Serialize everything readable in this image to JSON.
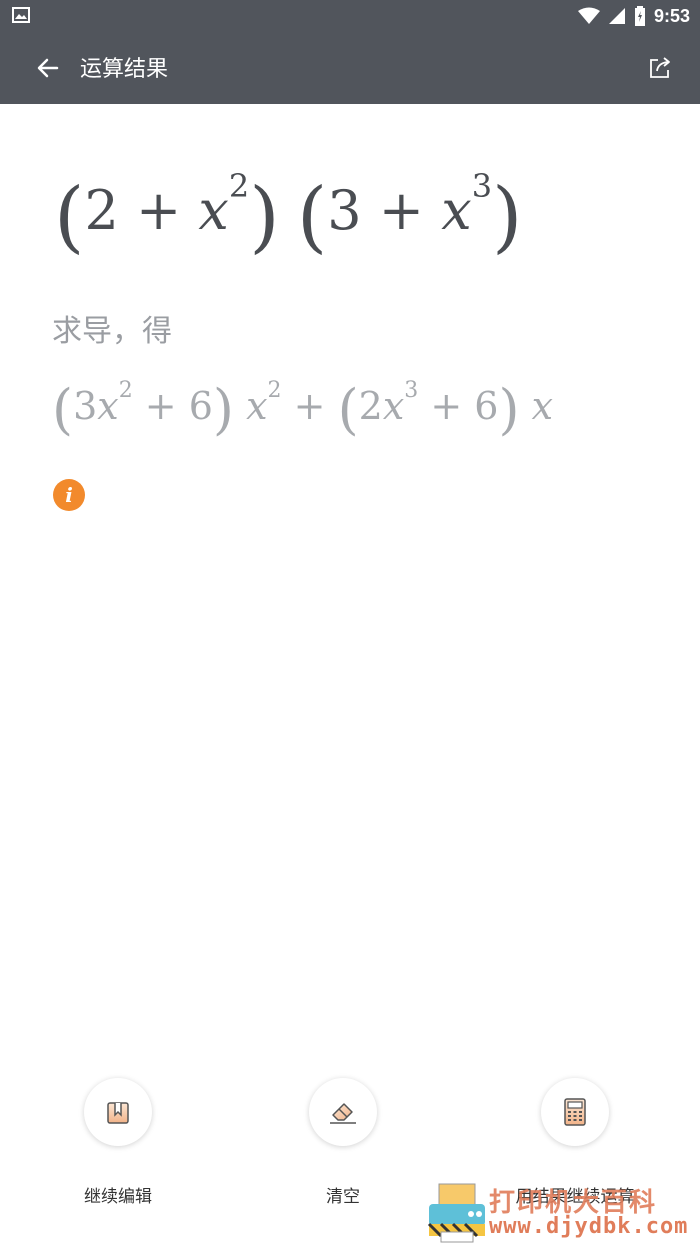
{
  "status_bar": {
    "time": "9:53"
  },
  "app_bar": {
    "title": "运算结果"
  },
  "input_expression": {
    "a": "2",
    "plus": "+",
    "var": "x",
    "exp1": "2",
    "b": "3",
    "exp2": "3"
  },
  "operation_label": "求导，得",
  "result_expression": {
    "c1": "3",
    "var": "x",
    "e1": "2",
    "plus": "+",
    "k": "6",
    "e2": "2",
    "c2": "2",
    "e3": "3"
  },
  "actions": [
    {
      "label": "继续编辑",
      "icon": "edit-document-icon"
    },
    {
      "label": "清空",
      "icon": "eraser-icon"
    },
    {
      "label": "用结果继续运算",
      "icon": "calculator-icon"
    }
  ],
  "watermark": {
    "text": "打印机大百科",
    "url": "www.djydbk.com"
  },
  "colors": {
    "app_bar": "#51555c",
    "accent": "#f28a2c",
    "background": "#ffffff"
  }
}
